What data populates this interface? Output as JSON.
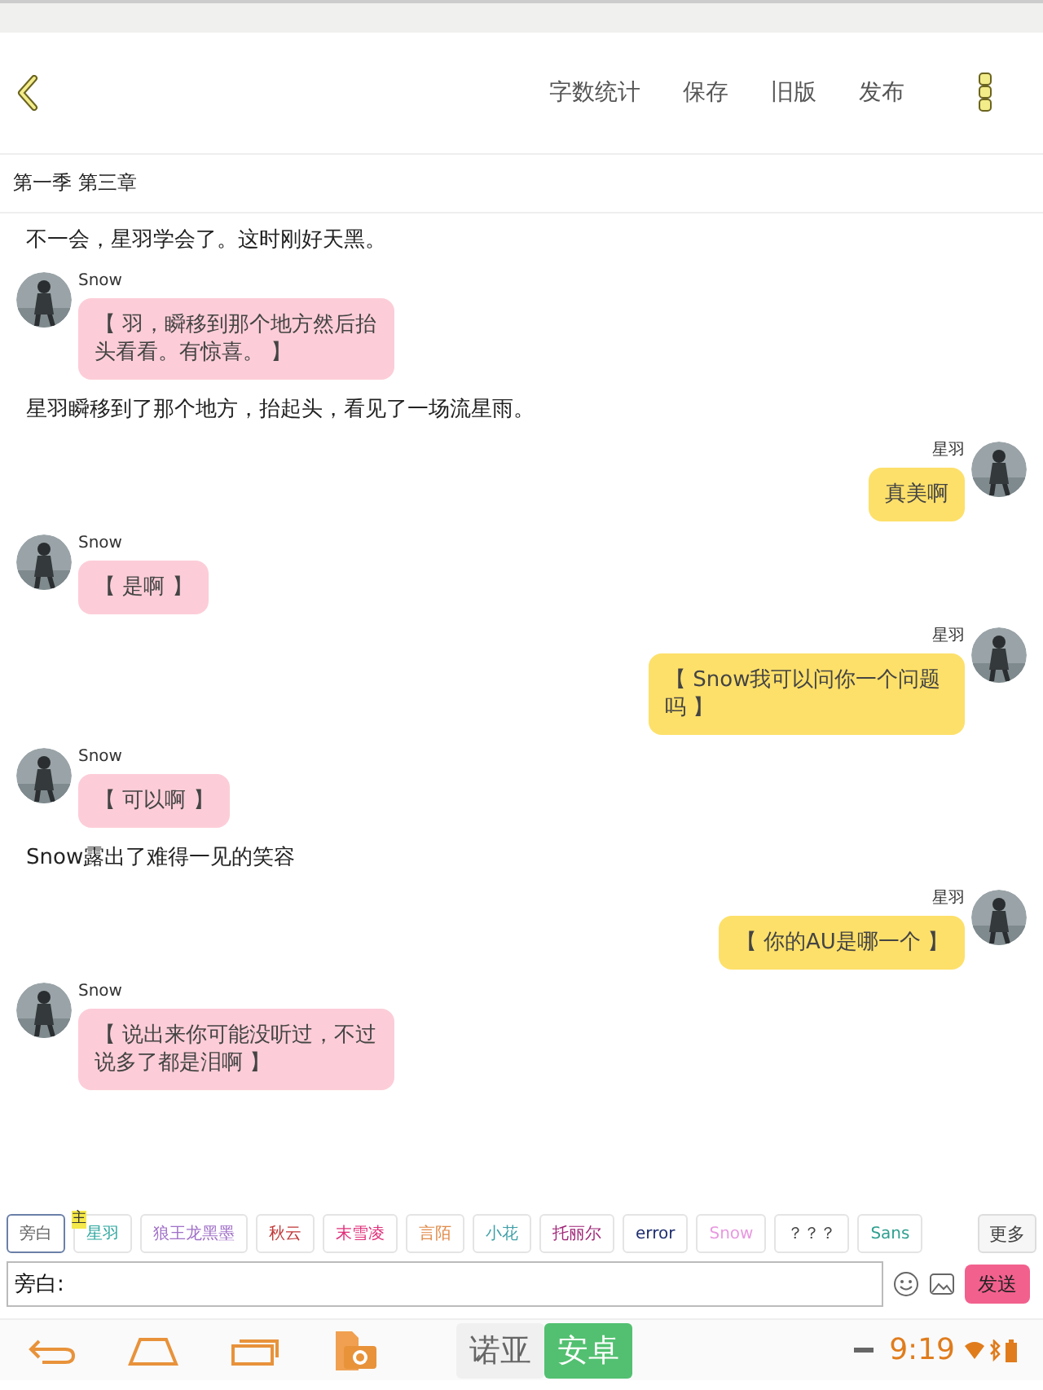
{
  "toolbar": {
    "actions": [
      "字数统计",
      "保存",
      "旧版",
      "发布"
    ]
  },
  "chapter": {
    "title": "第一季 第三章"
  },
  "messages": [
    {
      "kind": "narration",
      "text": "不一会，星羽学会了。这时刚好天黑。"
    },
    {
      "kind": "left",
      "name": "Snow",
      "text": "【 羽，瞬移到那个地方然后抬头看看。有惊喜。 】"
    },
    {
      "kind": "narration",
      "text": "星羽瞬移到了那个地方，抬起头，看见了一场流星雨。"
    },
    {
      "kind": "right",
      "name": "星羽",
      "text": "真美啊"
    },
    {
      "kind": "left",
      "name": "Snow",
      "text": "【 是啊 】"
    },
    {
      "kind": "right",
      "name": "星羽",
      "text": "【 Snow我可以问你一个问题吗 】"
    },
    {
      "kind": "left",
      "name": "Snow",
      "text": "【 可以啊 】"
    },
    {
      "kind": "narration",
      "text": "Snow露出了难得一见的笑容"
    },
    {
      "kind": "right",
      "name": "星羽",
      "text": "【 你的AU是哪一个 】"
    },
    {
      "kind": "left",
      "name": "Snow",
      "text": "【 说出来你可能没听过，不过说多了都是泪啊 】"
    }
  ],
  "characters": [
    {
      "label": "旁白",
      "color": "#666666",
      "selected": true
    },
    {
      "label": "星羽",
      "color": "#30a8a0",
      "selected": false,
      "badge": "主"
    },
    {
      "label": "狼王龙黑墨",
      "color": "#a070c8",
      "selected": false
    },
    {
      "label": "秋云",
      "color": "#c03838",
      "selected": false
    },
    {
      "label": "末雪凌",
      "color": "#e0307a",
      "selected": false
    },
    {
      "label": "言陌",
      "color": "#e08a48",
      "selected": false
    },
    {
      "label": "小花",
      "color": "#40a0a8",
      "selected": false
    },
    {
      "label": "托丽尔",
      "color": "#a02878",
      "selected": false
    },
    {
      "label": "error",
      "color": "#203070",
      "selected": false
    },
    {
      "label": "Snow",
      "color": "#e89ae0",
      "selected": false
    },
    {
      "label": "？？？",
      "color": "#444444",
      "selected": false
    },
    {
      "label": "Sans",
      "color": "#30a090",
      "selected": false
    }
  ],
  "more_button": "更多",
  "composer": {
    "value": "旁白:",
    "send": "发送"
  },
  "navbar": {
    "brand_left": "诺亚",
    "brand_right": "安卓",
    "time": "9:19"
  }
}
